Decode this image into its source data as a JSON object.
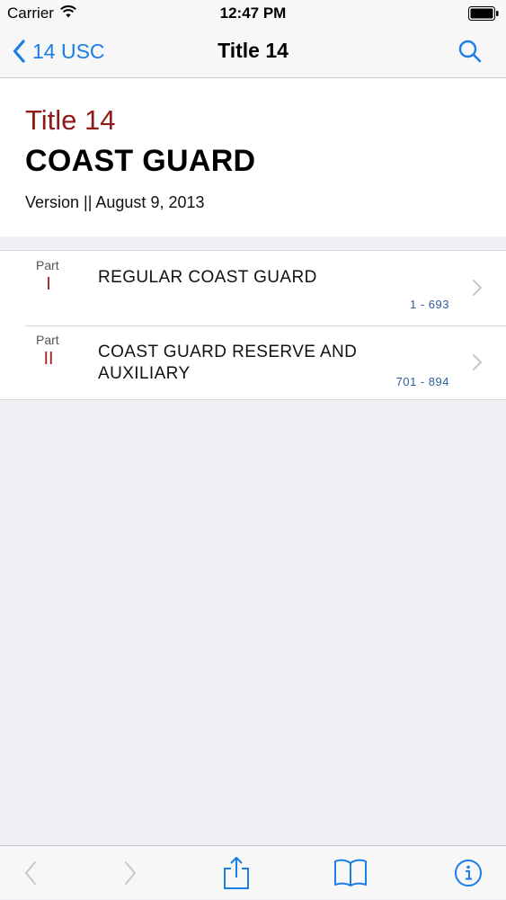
{
  "status_bar": {
    "carrier": "Carrier",
    "time": "12:47 PM"
  },
  "nav": {
    "back_label": "14 USC",
    "title": "Title 14"
  },
  "header": {
    "title_number": "Title 14",
    "title_name": "COAST GUARD",
    "version": "Version || August 9, 2013"
  },
  "parts": [
    {
      "label": "Part",
      "numeral": "I",
      "title": "REGULAR COAST GUARD",
      "range": "1 - 693"
    },
    {
      "label": "Part",
      "numeral": "II",
      "title": "COAST GUARD RESERVE AND AUXILIARY",
      "range": "701 - 894"
    }
  ],
  "toolbar": {
    "icons": [
      "chevron-left-icon",
      "chevron-right-icon",
      "share-icon",
      "book-icon",
      "info-icon"
    ]
  },
  "colors": {
    "accent": "#1a7ee6",
    "title_red": "#8f1a1a",
    "range_blue": "#2d5f9e",
    "background": "#efeff4"
  }
}
